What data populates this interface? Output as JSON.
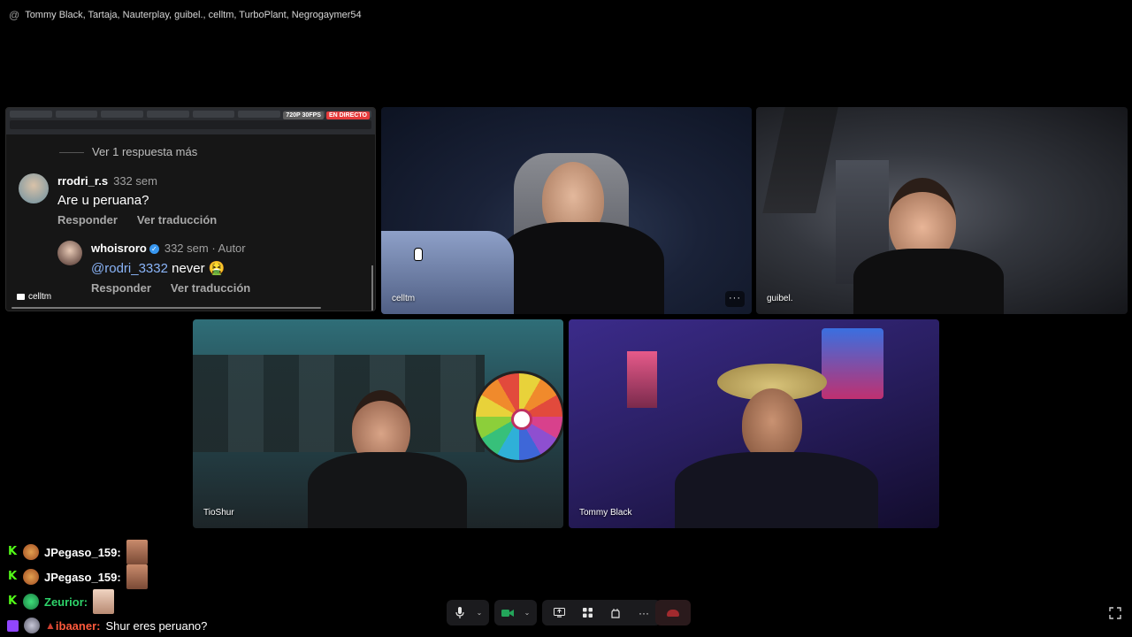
{
  "topbar": {
    "at_symbol": "@",
    "participants": "Tommy Black, Tartaja, Nauterplay, guibel., celltm, TurboPlant, Negrogaymer54"
  },
  "share_tile": {
    "quality_badge": "720P 30FPS",
    "live_badge": "EN DIRECTO",
    "more_replies": "Ver 1 respuesta más",
    "comment1": {
      "user": "rrodri_r.s",
      "meta": "332 sem",
      "text": "Are u peruana?",
      "reply": "Responder",
      "translate": "Ver traducción"
    },
    "comment2": {
      "user": "whoisroro",
      "meta": "332 sem · Autor",
      "mention": "@rodri_3332",
      "text": " never 🤮",
      "reply": "Responder",
      "translate": "Ver traducción"
    },
    "streamer_name": "celltm"
  },
  "tiles": {
    "cell": "celltm",
    "guibel": "guibel.",
    "tio": "TioShur",
    "tommy": "Tommy Black"
  },
  "chat": [
    {
      "platform": "kick",
      "user": "JPegaso_159:",
      "user_color": "#ffffff"
    },
    {
      "platform": "kick",
      "user": "JPegaso_159:",
      "user_color": "#ffffff"
    },
    {
      "platform": "kick",
      "user": "Zeurior:",
      "user_color": "#2ed36a"
    },
    {
      "platform": "twitch",
      "user": "ibaaner:",
      "user_color": "#ff5a3c",
      "text": "Shur eres peruano?"
    }
  ],
  "controls": {
    "mic_icon": "microphone-icon",
    "camera_icon": "camera-icon",
    "share_icon": "screen-share-icon",
    "activities_icon": "activities-icon",
    "soundboard_icon": "soundboard-icon",
    "more_icon": "more-icon",
    "leave_icon": "disconnect-icon"
  },
  "colors": {
    "live": "#e63b3b",
    "kick_green": "#53fc18",
    "twitch_purple": "#9146ff",
    "discord_green": "#23a55a"
  }
}
